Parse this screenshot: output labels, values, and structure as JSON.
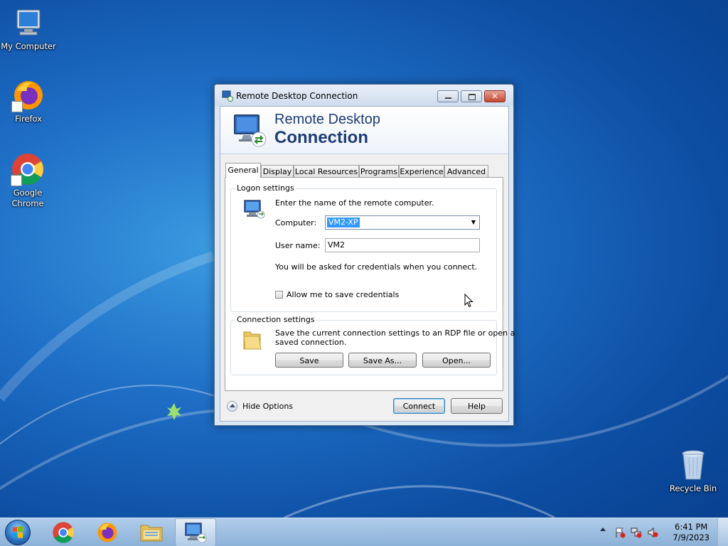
{
  "desktop": {
    "icons": [
      {
        "label": "My Computer",
        "icon": "computer-icon"
      },
      {
        "label": "Firefox",
        "icon": "firefox-icon"
      },
      {
        "label": "Google Chrome",
        "icon": "chrome-icon"
      },
      {
        "label": "Recycle Bin",
        "icon": "recycle-bin-icon"
      }
    ]
  },
  "window": {
    "title": "Remote Desktop Connection",
    "banner": {
      "line1": "Remote Desktop",
      "line2": "Connection"
    },
    "tabs": [
      "General",
      "Display",
      "Local Resources",
      "Programs",
      "Experience",
      "Advanced"
    ],
    "active_tab": "General",
    "logon": {
      "group_label": "Logon settings",
      "intro": "Enter the name of the remote computer.",
      "computer_label": "Computer:",
      "computer_value": "VM2-XP",
      "username_label": "User name:",
      "username_value": "VM2",
      "credentials_note": "You will be asked for credentials when you connect.",
      "save_credentials_label": "Allow me to save credentials",
      "save_credentials_checked": false
    },
    "connection": {
      "group_label": "Connection settings",
      "description_line1": "Save the current connection settings to an RDP file or open a",
      "description_line2": "saved connection.",
      "save_label": "Save",
      "save_as_label": "Save As...",
      "open_label": "Open..."
    },
    "footer": {
      "hide_options_label": "Hide Options",
      "connect_label": "Connect",
      "help_label": "Help"
    }
  },
  "taskbar": {
    "pinned": [
      "chrome-icon",
      "firefox-icon",
      "file-explorer-icon",
      "remote-desktop-icon"
    ],
    "active": "remote-desktop-icon",
    "clock": {
      "time": "6:41 PM",
      "date": "7/9/2023"
    }
  },
  "colors": {
    "selection": "#3399ff",
    "banner_text": "#1e3c78"
  }
}
